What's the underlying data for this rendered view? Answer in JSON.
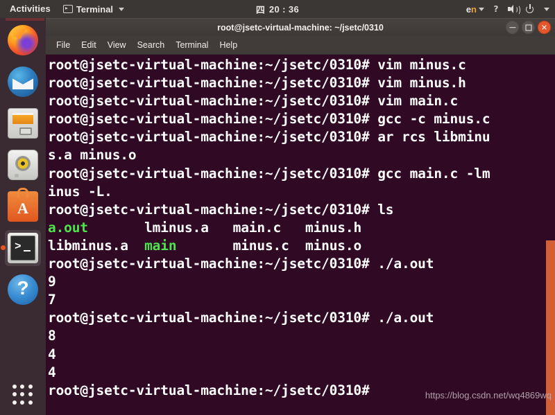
{
  "topbar": {
    "activities": "Activities",
    "app_name": "Terminal",
    "app_icon": "terminal-icon",
    "clock_day": "四",
    "clock_time": "20 : 36",
    "language": "en",
    "language_first": "e",
    "language_second": "n",
    "accessibility_icon": "accessibility-icon",
    "volume_icon": "volume-icon",
    "power_icon": "power-icon",
    "caret_icon": "chevron-down-icon"
  },
  "dock": {
    "items": [
      {
        "name": "firefox",
        "label": "Firefox",
        "active": false
      },
      {
        "name": "thunderbird",
        "label": "Thunderbird Mail",
        "active": false
      },
      {
        "name": "files",
        "label": "Files",
        "active": false
      },
      {
        "name": "rhythmbox",
        "label": "Rhythmbox",
        "active": false
      },
      {
        "name": "ubuntu-software",
        "label": "Ubuntu Software",
        "active": false
      },
      {
        "name": "terminal",
        "label": "Terminal",
        "active": true
      },
      {
        "name": "help",
        "label": "Help",
        "active": false
      }
    ],
    "app_grid_label": "Show Applications"
  },
  "window": {
    "title": "root@jsetc-virtual-machine: ~/jsetc/0310",
    "controls": {
      "minimize": "–",
      "maximize": "□",
      "close": "✕"
    },
    "menu": [
      "File",
      "Edit",
      "View",
      "Search",
      "Terminal",
      "Help"
    ]
  },
  "terminal": {
    "prompt": "root@jsetc-virtual-machine:~/jsetc/0310# ",
    "watermark": "https://blog.csdn.net/wq4869wq",
    "lines": [
      {
        "type": "prompt",
        "command": "vim minus.c"
      },
      {
        "type": "prompt",
        "command": "vim minus.h"
      },
      {
        "type": "prompt",
        "command": "vim main.c"
      },
      {
        "type": "prompt",
        "command": "gcc -c minus.c"
      },
      {
        "type": "prompt",
        "command": "ar rcs libminu"
      },
      {
        "type": "output",
        "text": "s.a minus.o"
      },
      {
        "type": "prompt",
        "command": "gcc main.c -lm"
      },
      {
        "type": "output",
        "text": "inus -L."
      },
      {
        "type": "prompt",
        "command": "ls"
      },
      {
        "type": "ls",
        "cells": [
          {
            "text": "a.out",
            "color": "green",
            "width": 12
          },
          {
            "text": "lminus.a",
            "color": "white",
            "width": 11
          },
          {
            "text": "main.c",
            "color": "white",
            "width": 9
          },
          {
            "text": "minus.h",
            "color": "white",
            "width": 0
          }
        ]
      },
      {
        "type": "ls",
        "cells": [
          {
            "text": "libminus.a",
            "color": "white",
            "width": 12
          },
          {
            "text": "main",
            "color": "green",
            "width": 11
          },
          {
            "text": "minus.c",
            "color": "white",
            "width": 9
          },
          {
            "text": "minus.o",
            "color": "white",
            "width": 0
          }
        ]
      },
      {
        "type": "prompt",
        "command": "./a.out"
      },
      {
        "type": "output",
        "text": "9"
      },
      {
        "type": "output",
        "text": "7"
      },
      {
        "type": "prompt",
        "command": "./a.out"
      },
      {
        "type": "output",
        "text": "8"
      },
      {
        "type": "output",
        "text": "4"
      },
      {
        "type": "output",
        "text": "4"
      },
      {
        "type": "prompt",
        "command": ""
      }
    ]
  },
  "colors": {
    "terminal_bg": "#300a24",
    "terminal_fg": "#ffffff",
    "terminal_green": "#4ee44e",
    "accent_orange": "#e95420",
    "scrollbar": "#d35f37",
    "topbar_bg": "#3b3735",
    "dock_bg": "#3a2b33"
  }
}
